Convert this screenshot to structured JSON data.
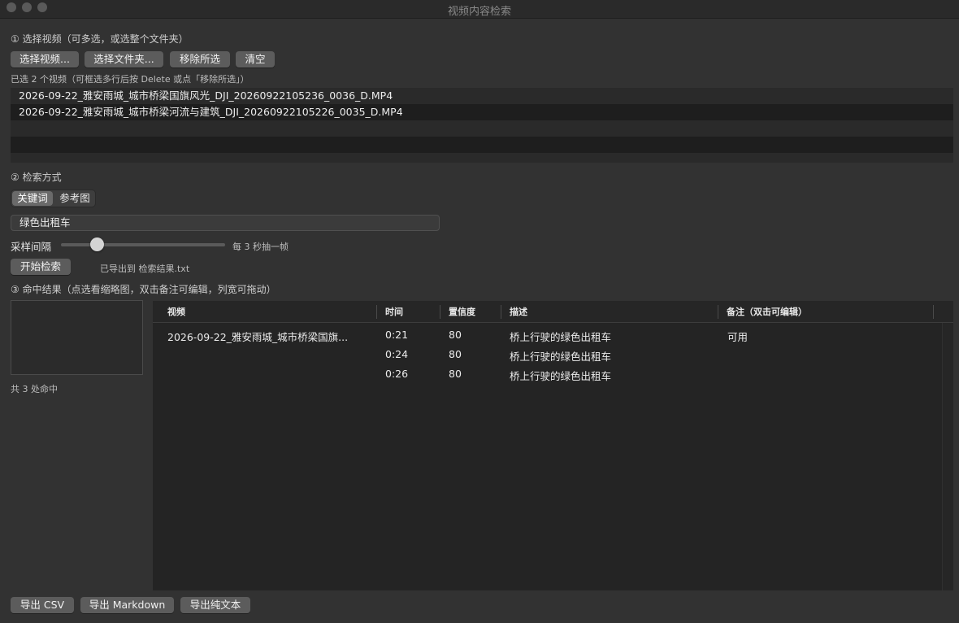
{
  "window": {
    "title": "视频内容检索"
  },
  "step1": {
    "label": "① 选择视频（可多选，或选整个文件夹）",
    "buttons": {
      "choose_videos": "选择视频...",
      "choose_folder": "选择文件夹...",
      "remove_selected": "移除所选",
      "clear": "清空"
    },
    "selected_hint": "已选 2 个视频（可框选多行后按 Delete 或点「移除所选」）",
    "files": [
      "2026-09-22_雅安雨城_城市桥梁国旗风光_DJI_20260922105236_0036_D.MP4",
      "2026-09-22_雅安雨城_城市桥梁河流与建筑_DJI_20260922105226_0035_D.MP4"
    ]
  },
  "step2": {
    "label": "② 检索方式",
    "modes": [
      "关键词",
      "参考图"
    ],
    "active_mode": "关键词",
    "keyword_value": "绿色出租车",
    "interval_label": "采样间隔",
    "interval_value_text": "每 3 秒抽一帧",
    "interval_slider_fraction": 0.22,
    "start_button": "开始检索",
    "export_status": "已导出到 检索结果.txt"
  },
  "step3": {
    "label": "③ 命中结果（点选看缩略图，双击备注可编辑，列宽可拖动）",
    "hit_count": "共 3 处命中",
    "columns": [
      "视频",
      "时间",
      "置信度",
      "描述",
      "备注（双击可编辑）"
    ],
    "rows": [
      {
        "video": "2026-09-22_雅安雨城_城市桥梁国旗...",
        "time": "0:21",
        "confidence": "80",
        "desc": "桥上行驶的绿色出租车",
        "note": "可用"
      },
      {
        "video": "",
        "time": "0:24",
        "confidence": "80",
        "desc": "桥上行驶的绿色出租车",
        "note": ""
      },
      {
        "video": "",
        "time": "0:26",
        "confidence": "80",
        "desc": "桥上行驶的绿色出租车",
        "note": ""
      }
    ]
  },
  "export": {
    "csv": "导出 CSV",
    "markdown": "导出 Markdown",
    "text": "导出纯文本"
  },
  "colors": {
    "background": "#323232",
    "list_background": "#1e1e1e",
    "button": "#5c5c5c"
  }
}
